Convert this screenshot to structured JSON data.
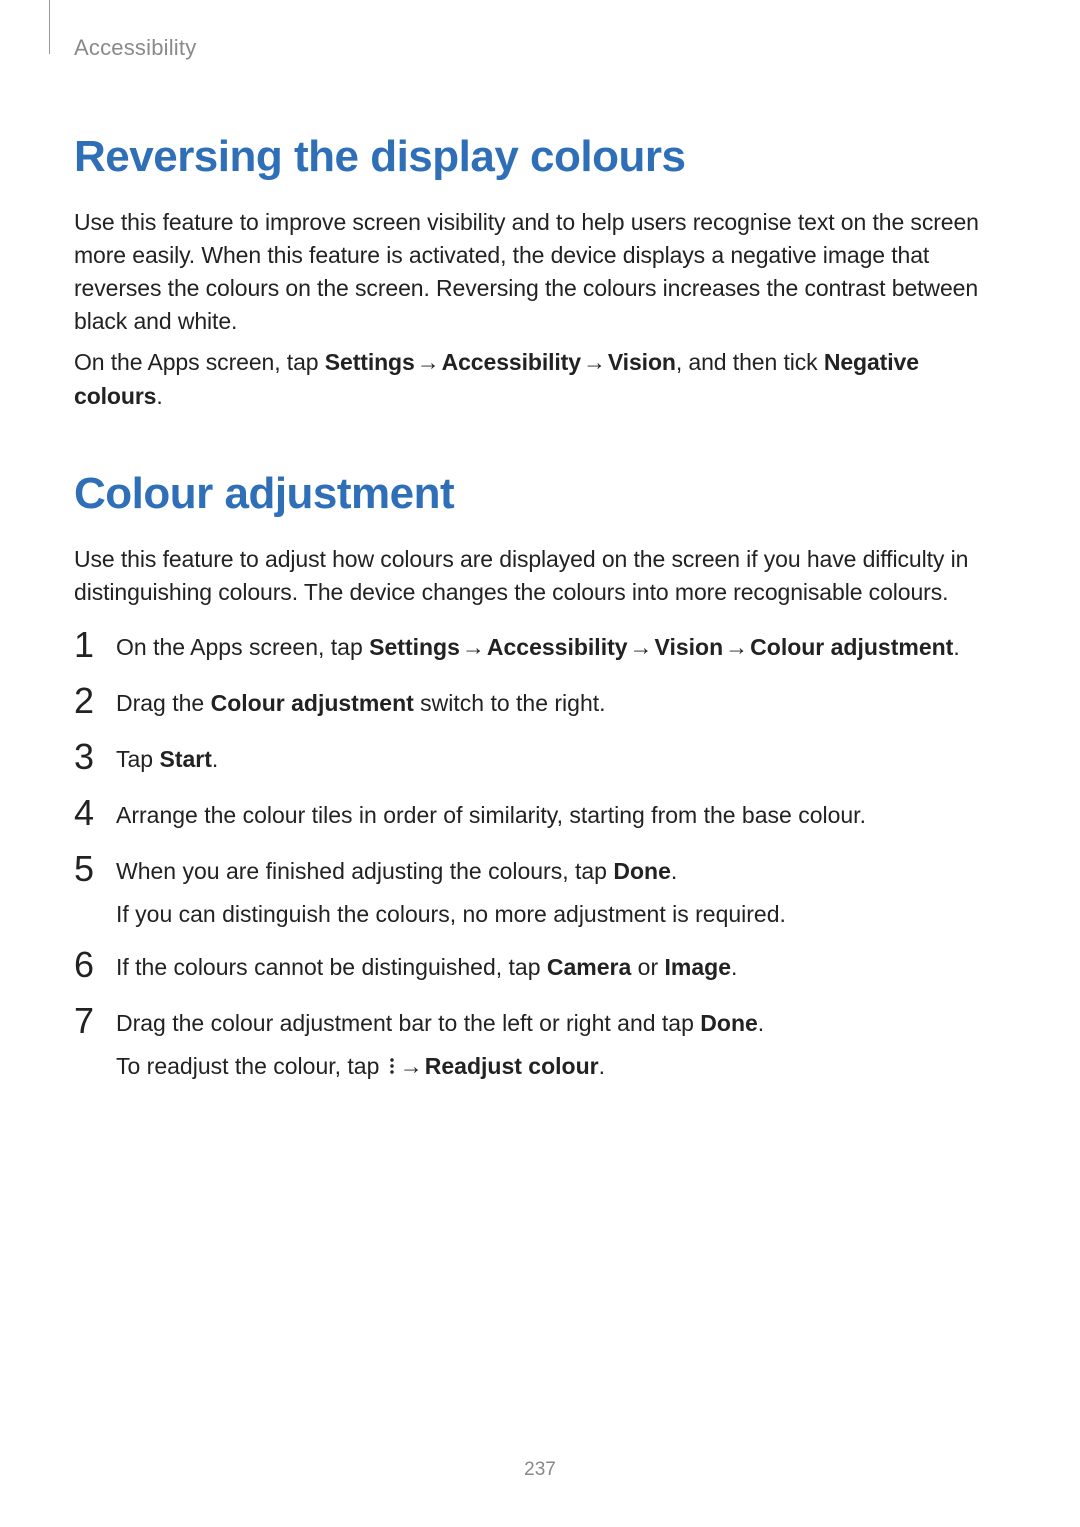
{
  "runningHead": "Accessibility",
  "section1": {
    "title": "Reversing the display colours",
    "p1": "Use this feature to improve screen visibility and to help users recognise text on the screen more easily. When this feature is activated, the device displays a negative image that reverses the colours on the screen. Reversing the colours increases the contrast between black and white.",
    "p2_pre": "On the Apps screen, tap ",
    "p2_settings": "Settings",
    "p2_arrow": " → ",
    "p2_acc": "Accessibility",
    "p2_vision": "Vision",
    "p2_mid": ", and then tick ",
    "p2_neg": "Negative colours",
    "p2_end": "."
  },
  "section2": {
    "title": "Colour adjustment",
    "p1": "Use this feature to adjust how colours are displayed on the screen if you have difficulty in distinguishing colours. The device changes the colours into more recognisable colours.",
    "steps": {
      "s1": {
        "num": "1",
        "pre": "On the Apps screen, tap ",
        "settings": "Settings",
        "arrow": " → ",
        "acc": "Accessibility",
        "vision": "Vision",
        "ca": "Colour adjustment",
        "end": "."
      },
      "s2": {
        "num": "2",
        "pre": "Drag the ",
        "ca": "Colour adjustment",
        "post": " switch to the right."
      },
      "s3": {
        "num": "3",
        "pre": "Tap ",
        "start": "Start",
        "end": "."
      },
      "s4": {
        "num": "4",
        "text": "Arrange the colour tiles in order of similarity, starting from the base colour."
      },
      "s5": {
        "num": "5",
        "pre": "When you are finished adjusting the colours, tap ",
        "done": "Done",
        "end": ".",
        "line2": "If you can distinguish the colours, no more adjustment is required."
      },
      "s6": {
        "num": "6",
        "pre": "If the colours cannot be distinguished, tap ",
        "camera": "Camera",
        "or": " or ",
        "image": "Image",
        "end": "."
      },
      "s7": {
        "num": "7",
        "pre": "Drag the colour adjustment bar to the left or right and tap ",
        "done": "Done",
        "end": ".",
        "l2pre": "To readjust the colour, tap ",
        "arrow": " → ",
        "readjust": "Readjust colour",
        "l2end": "."
      }
    }
  },
  "pageNumber": "237",
  "colors": {
    "heading": "#2f6fb8",
    "body": "#222222",
    "muted": "#8a8a8a"
  }
}
